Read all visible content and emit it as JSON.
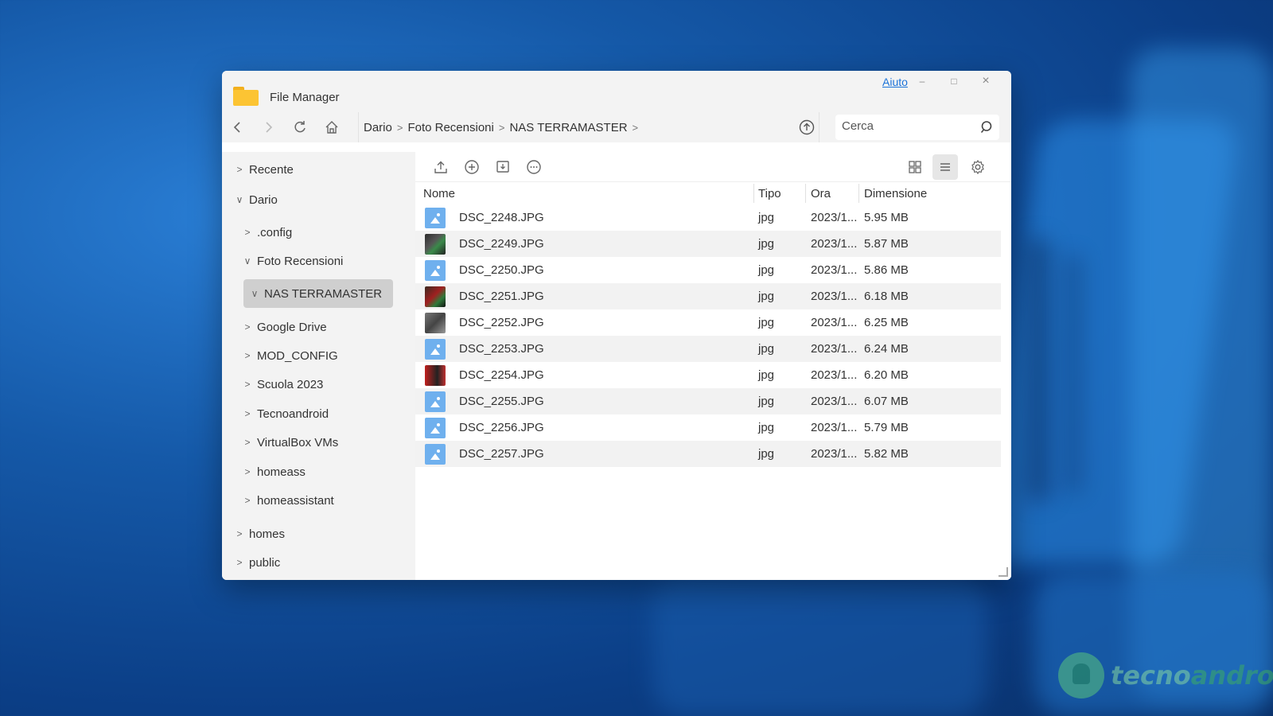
{
  "window": {
    "title": "File Manager",
    "help_label": "Aiuto",
    "min_glyph": "–",
    "max_glyph": "□",
    "close_glyph": "×"
  },
  "toolbar": {
    "breadcrumb": [
      "Dario",
      "Foto Recensioni",
      "NAS TERRAMASTER"
    ],
    "search_placeholder": "Cerca"
  },
  "sidebar": {
    "items": [
      {
        "label": "Recente",
        "expanded": false,
        "level": 0
      },
      {
        "label": "Dario",
        "expanded": true,
        "level": 0
      },
      {
        "label": ".config",
        "expanded": false,
        "level": 1
      },
      {
        "label": "Foto Recensioni",
        "expanded": true,
        "level": 1
      },
      {
        "label": "NAS TERRAMASTER",
        "expanded": true,
        "level": 2,
        "selected": true
      },
      {
        "label": "Google Drive",
        "expanded": false,
        "level": 1
      },
      {
        "label": "MOD_CONFIG",
        "expanded": false,
        "level": 1
      },
      {
        "label": "Scuola 2023",
        "expanded": false,
        "level": 1
      },
      {
        "label": "Tecnoandroid",
        "expanded": false,
        "level": 1
      },
      {
        "label": "VirtualBox VMs",
        "expanded": false,
        "level": 1
      },
      {
        "label": "homeass",
        "expanded": false,
        "level": 1
      },
      {
        "label": "homeassistant",
        "expanded": false,
        "level": 1
      },
      {
        "label": "homes",
        "expanded": false,
        "level": 0
      },
      {
        "label": "public",
        "expanded": false,
        "level": 0
      }
    ]
  },
  "table": {
    "columns": [
      "Nome",
      "Tipo",
      "Ora",
      "Dimensione"
    ],
    "rows": [
      {
        "name": "DSC_2248.JPG",
        "type": "jpg",
        "time": "2023/1...",
        "size": "5.95 MB",
        "thumb": "image-icon"
      },
      {
        "name": "DSC_2249.JPG",
        "type": "jpg",
        "time": "2023/1...",
        "size": "5.87 MB",
        "thumb": "photo"
      },
      {
        "name": "DSC_2250.JPG",
        "type": "jpg",
        "time": "2023/1...",
        "size": "5.86 MB",
        "thumb": "image-icon"
      },
      {
        "name": "DSC_2251.JPG",
        "type": "jpg",
        "time": "2023/1...",
        "size": "6.18 MB",
        "thumb": "photo"
      },
      {
        "name": "DSC_2252.JPG",
        "type": "jpg",
        "time": "2023/1...",
        "size": "6.25 MB",
        "thumb": "photo"
      },
      {
        "name": "DSC_2253.JPG",
        "type": "jpg",
        "time": "2023/1...",
        "size": "6.24 MB",
        "thumb": "image-icon"
      },
      {
        "name": "DSC_2254.JPG",
        "type": "jpg",
        "time": "2023/1...",
        "size": "6.20 MB",
        "thumb": "photo"
      },
      {
        "name": "DSC_2255.JPG",
        "type": "jpg",
        "time": "2023/1...",
        "size": "6.07 MB",
        "thumb": "image-icon"
      },
      {
        "name": "DSC_2256.JPG",
        "type": "jpg",
        "time": "2023/1...",
        "size": "5.79 MB",
        "thumb": "image-icon"
      },
      {
        "name": "DSC_2257.JPG",
        "type": "jpg",
        "time": "2023/1...",
        "size": "5.82 MB",
        "thumb": "image-icon"
      }
    ]
  },
  "watermark": {
    "part1": "tecno",
    "part2": "android"
  },
  "colors": {
    "accent": "#1a73d9",
    "folder": "#fcc433",
    "selected": "#cfcfcf"
  }
}
